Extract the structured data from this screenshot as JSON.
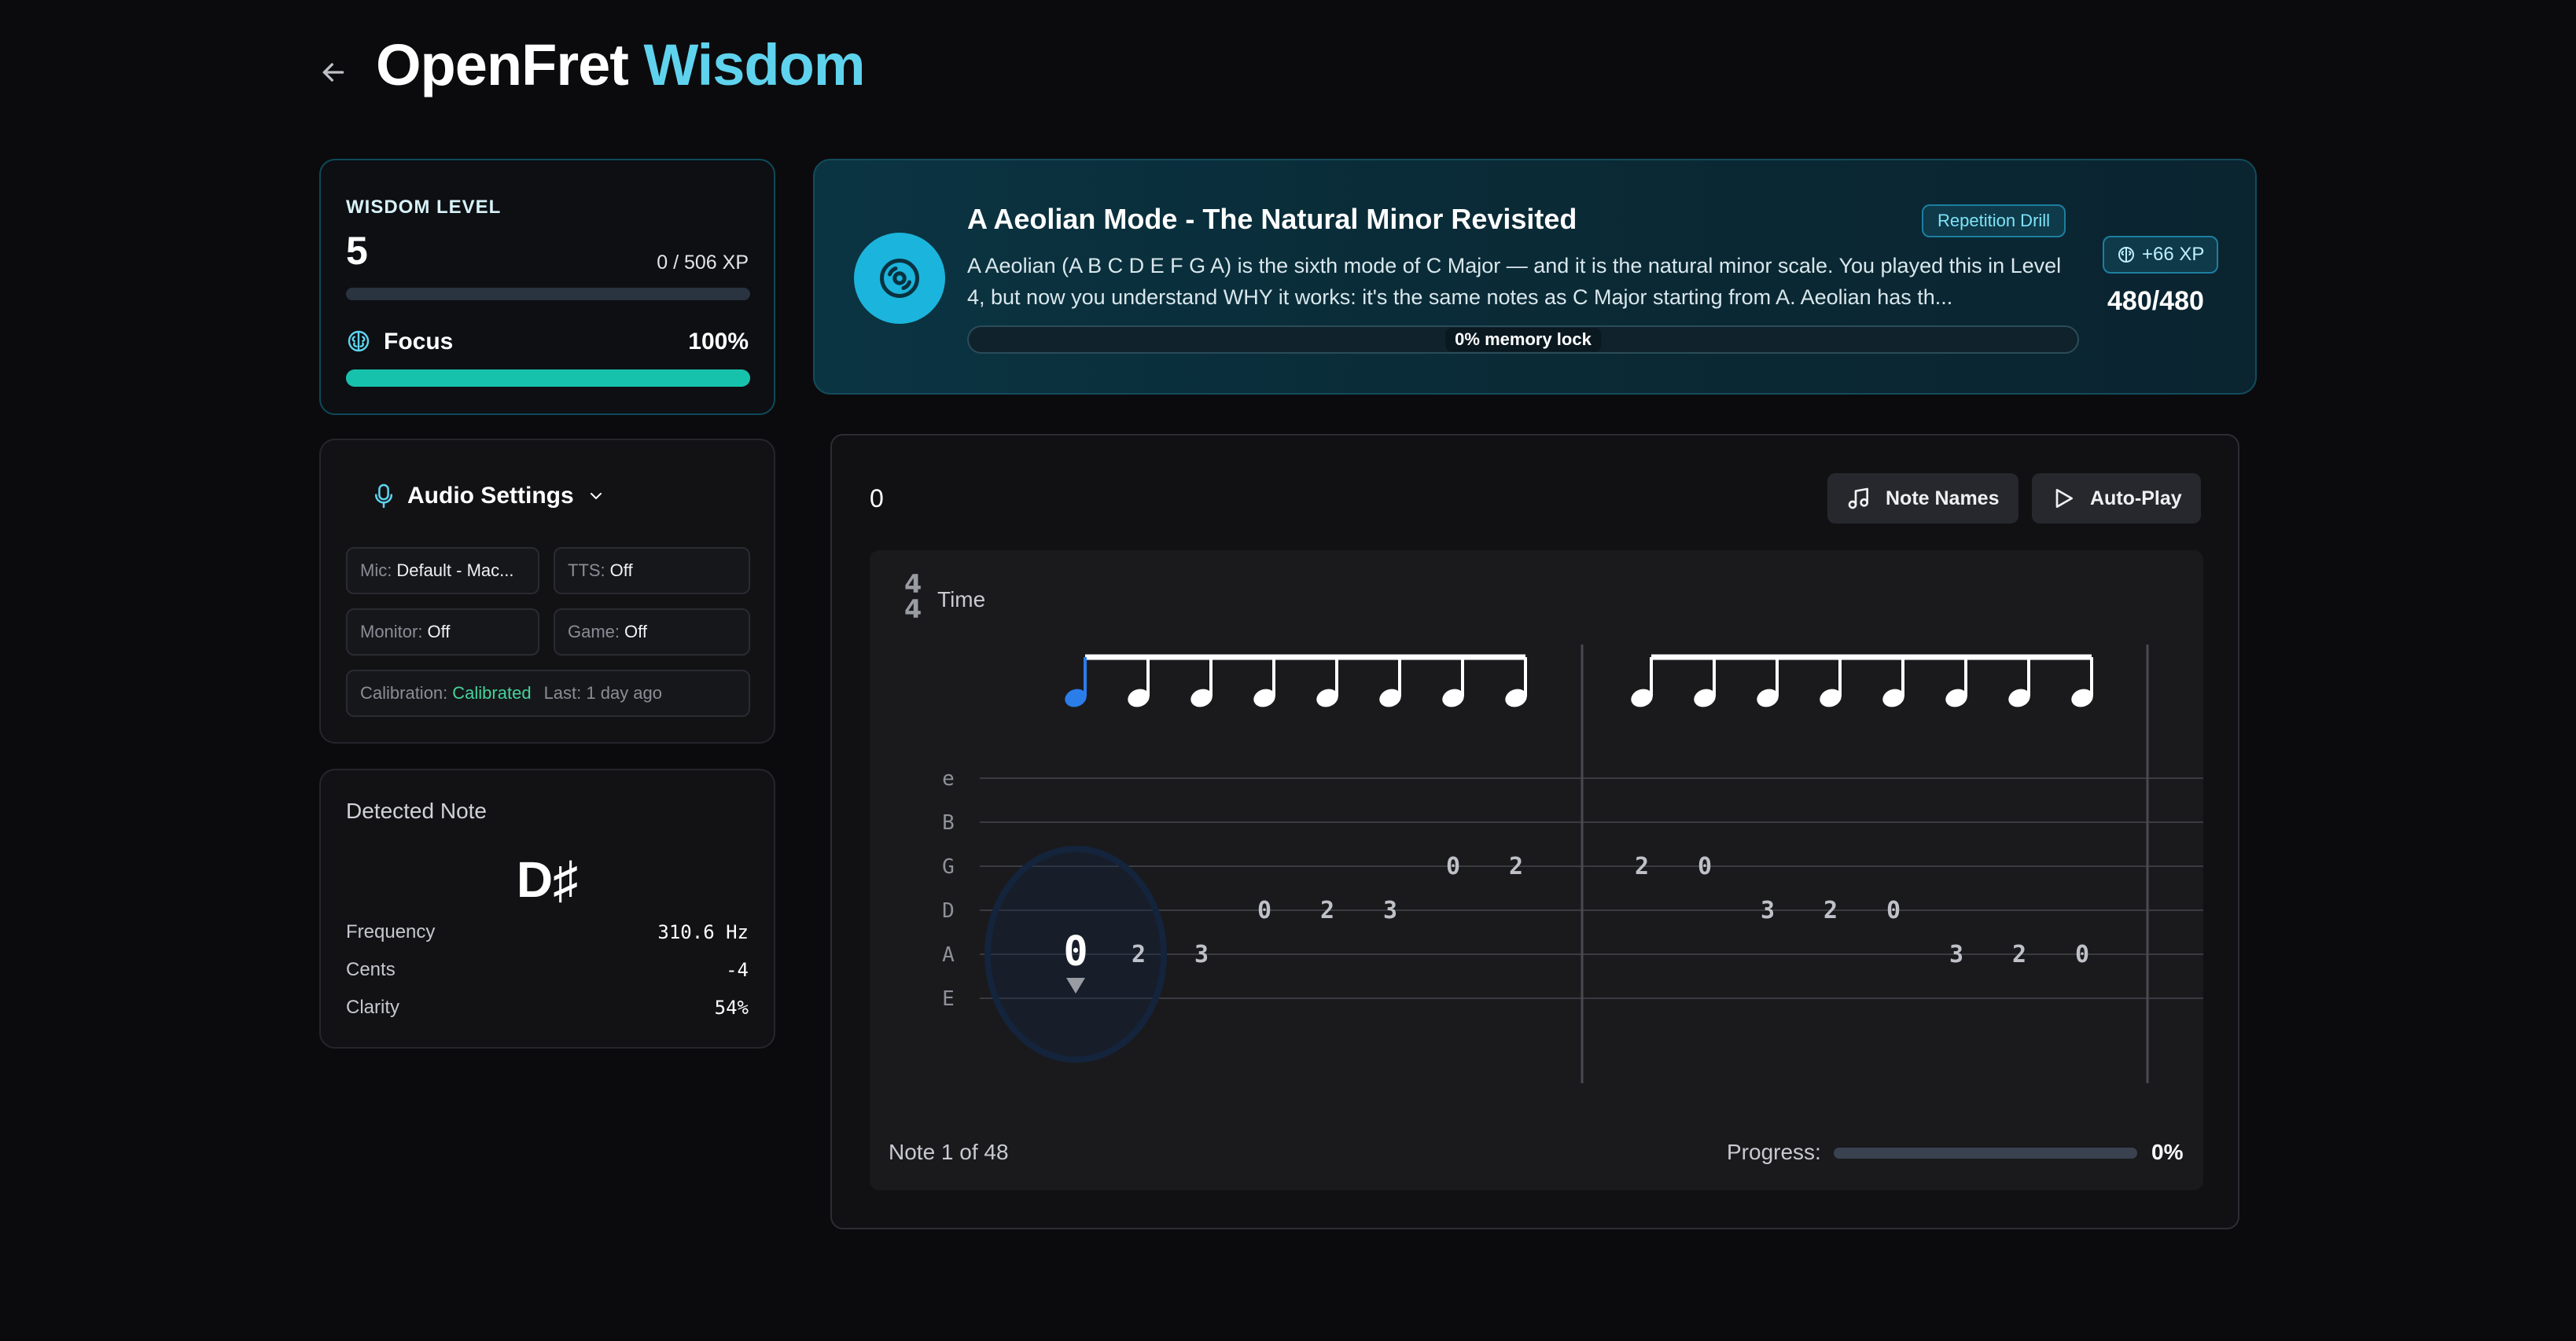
{
  "header": {
    "title_main": "OpenFret",
    "title_accent": "Wisdom"
  },
  "wisdom": {
    "label": "WISDOM LEVEL",
    "level": "5",
    "xp_text": "0 / 506 XP",
    "xp_fraction": 0.0,
    "focus_label": "Focus",
    "focus_value": "100%",
    "focus_fraction": 1.0
  },
  "audio": {
    "title": "Audio Settings",
    "mic_key": "Mic:",
    "mic_val": "Default - Mac...",
    "tts_key": "TTS:",
    "tts_val": "Off",
    "monitor_key": "Monitor:",
    "monitor_val": "Off",
    "game_key": "Game:",
    "game_val": "Off",
    "cal_key": "Calibration:",
    "cal_val": "Calibrated",
    "last_text": "Last: 1 day ago"
  },
  "detected": {
    "title": "Detected Note",
    "note": "D♯",
    "freq_label": "Frequency",
    "freq_val": "310.6 Hz",
    "cents_label": "Cents",
    "cents_val": "-4",
    "clarity_label": "Clarity",
    "clarity_val": "54%"
  },
  "lesson": {
    "title": "A Aeolian Mode - The Natural Minor Revisited",
    "badge": "Repetition Drill",
    "description": "A Aeolian (A B C D E F G A) is the sixth mode of C Major — and it is the natural minor scale. You played this in Level 4, but now you understand WHY it works: it's the same notes as C Major starting from A. Aeolian has th...",
    "memory_lock": "0% memory lock",
    "memory_fraction": 0.0,
    "xp_badge": "+66 XP",
    "score": "480/480"
  },
  "tab": {
    "counter": "0",
    "note_names_label": "Note Names",
    "autoplay_label": "Auto-Play",
    "time_top": "4",
    "time_bottom": "4",
    "time_label": "Time",
    "strings": [
      "e",
      "B",
      "G",
      "D",
      "A",
      "E"
    ],
    "notes": [
      {
        "string": "A",
        "fret": "0"
      },
      {
        "string": "A",
        "fret": "2"
      },
      {
        "string": "A",
        "fret": "3"
      },
      {
        "string": "D",
        "fret": "0"
      },
      {
        "string": "D",
        "fret": "2"
      },
      {
        "string": "D",
        "fret": "3"
      },
      {
        "string": "G",
        "fret": "0"
      },
      {
        "string": "G",
        "fret": "2"
      },
      {
        "string": "G",
        "fret": "2"
      },
      {
        "string": "G",
        "fret": "0"
      },
      {
        "string": "D",
        "fret": "3"
      },
      {
        "string": "D",
        "fret": "2"
      },
      {
        "string": "D",
        "fret": "0"
      },
      {
        "string": "A",
        "fret": "3"
      },
      {
        "string": "A",
        "fret": "2"
      },
      {
        "string": "A",
        "fret": "0"
      }
    ],
    "footer_text": "Note 1 of 48",
    "progress_label": "Progress:",
    "progress_value": "0%",
    "progress_fraction": 0.0
  },
  "colors": {
    "accent": "#5fd3ee",
    "focus_bar": "#17c2ad",
    "calibrated": "#46d39a",
    "active_note": "#2b7de9"
  },
  "icons": {
    "back": "arrow-left-icon",
    "focus": "brain-icon",
    "mic": "microphone-icon",
    "chevron": "chevron-down-icon",
    "lesson": "disc-icon",
    "xp": "brain-icon",
    "note_names": "music-note-icon",
    "autoplay": "play-icon"
  }
}
